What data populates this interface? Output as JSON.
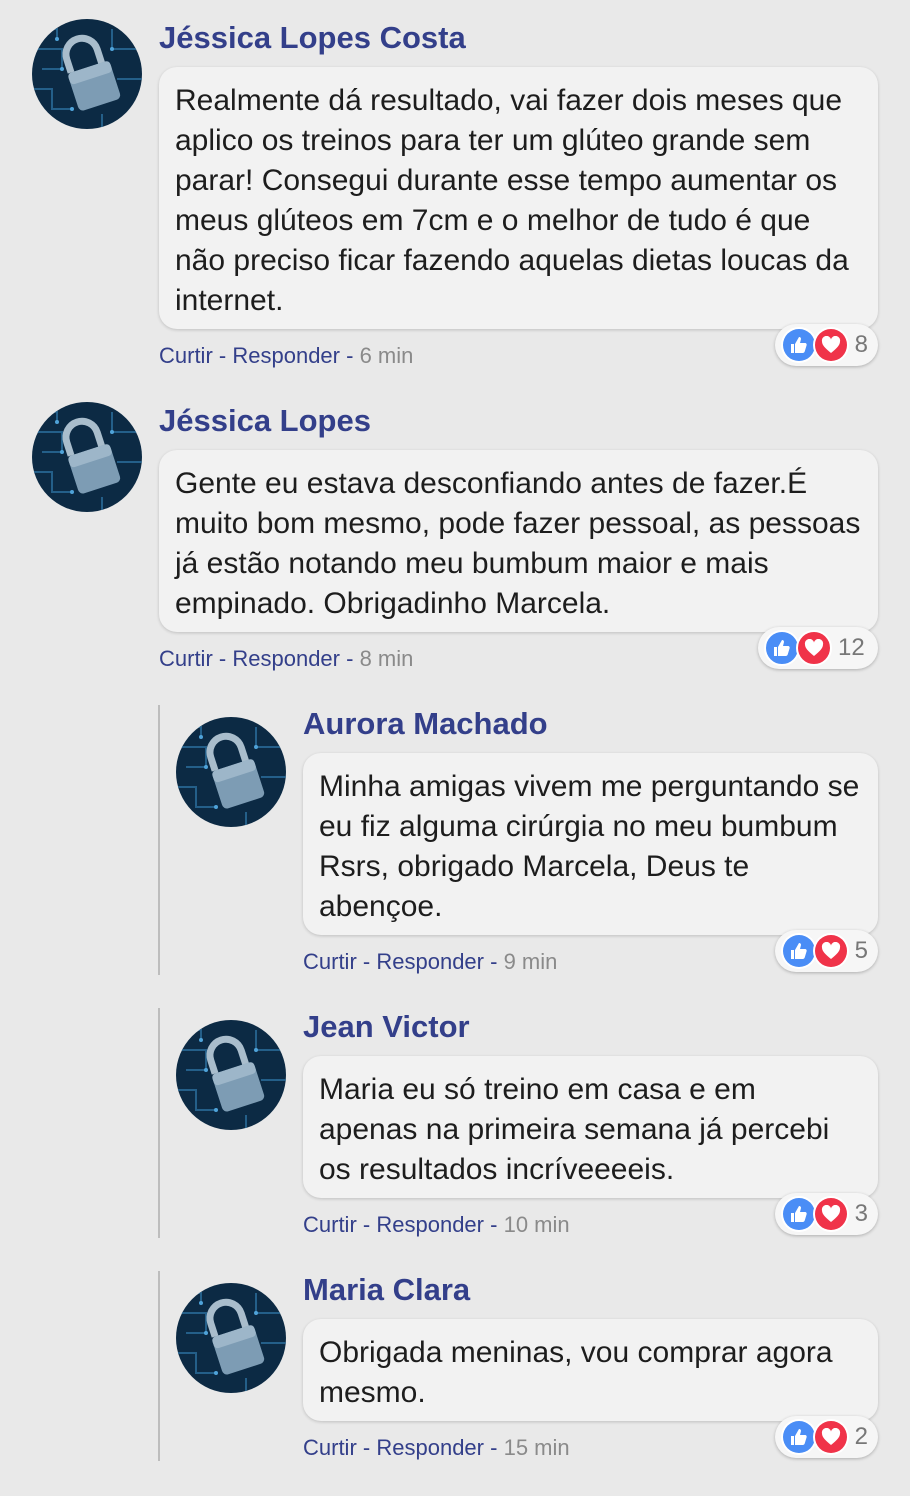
{
  "comments": [
    {
      "author": "Jéssica Lopes Costa",
      "text": "Realmente dá resultado, vai fazer dois meses que aplico os treinos para ter um glúteo grande sem parar! Consegui durante esse tempo aumentar os meus glúteos em 7cm e o melhor de tudo é que não preciso ficar fazendo aquelas dietas loucas da internet.",
      "like_label": "Curtir",
      "separator": "-",
      "reply_label": "Responder",
      "time": "6 min",
      "reaction_count": "8"
    },
    {
      "author": "Jéssica Lopes",
      "text": "Gente eu estava desconfiando antes de fazer.É muito bom mesmo, pode fazer pessoal, as pessoas já estão notando meu bumbum maior e mais empinado. Obrigadinho Marcela.",
      "like_label": "Curtir",
      "separator": "-",
      "reply_label": "Responder",
      "time": "8 min",
      "reaction_count": "12"
    },
    {
      "author": "Aurora Machado",
      "text": "Minha amigas vivem me perguntando se eu fiz alguma cirúrgia no meu bumbum Rsrs, obrigado Marcela, Deus te abençoe.",
      "like_label": "Curtir",
      "separator": "-",
      "reply_label": "Responder",
      "time": "9 min",
      "reaction_count": "5"
    },
    {
      "author": "Jean Victor",
      "text": "Maria eu só treino em casa e em apenas na primeira semana já percebi os resultados incríveeeeis.",
      "like_label": "Curtir",
      "separator": "-",
      "reply_label": "Responder",
      "time": "10 min",
      "reaction_count": "3"
    },
    {
      "author": "Maria Clara",
      "text": "Obrigada meninas, vou comprar agora mesmo.",
      "like_label": "Curtir",
      "separator": "-",
      "reply_label": "Responder",
      "time": "15 min",
      "reaction_count": "2"
    }
  ],
  "icons": {
    "avatar": "padlock-avatar-icon",
    "like": "thumbs-up-icon",
    "love": "heart-icon"
  },
  "colors": {
    "author": "#333f8a",
    "background": "#e9e9e9",
    "bubble": "#f2f2f2",
    "like": "#4a8df6",
    "love": "#f03349"
  }
}
